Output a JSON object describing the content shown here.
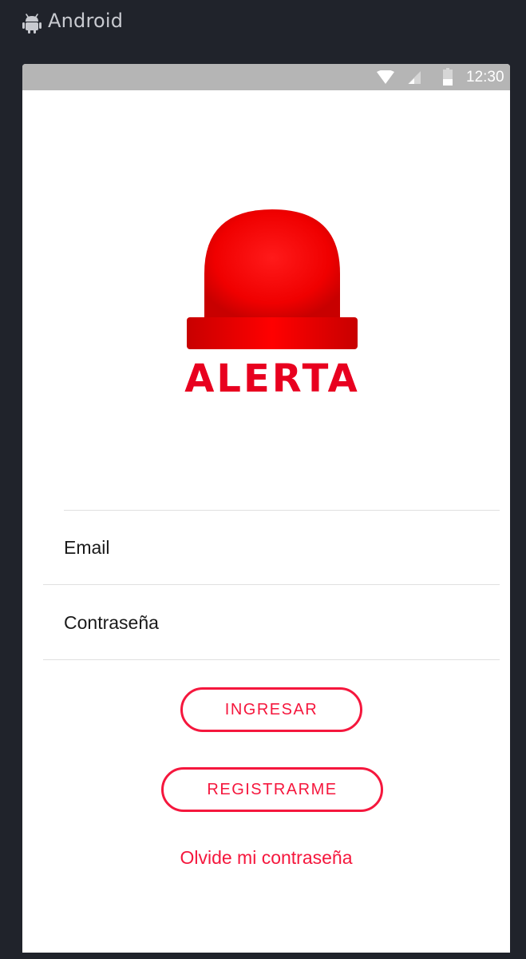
{
  "window": {
    "title": "Android",
    "icon": "android-robot-icon"
  },
  "status_bar": {
    "time": "12:30",
    "icons": [
      "wifi-icon",
      "signal-icon",
      "battery-icon"
    ]
  },
  "logo": {
    "text": "ALERTA",
    "icon": "siren-icon",
    "color": "#e8001f"
  },
  "form": {
    "email_placeholder": "Email",
    "password_placeholder": "Contraseña"
  },
  "buttons": {
    "login_label": "INGRESAR",
    "register_label": "REGISTRARME",
    "forgot_label": "Olvide mi contraseña"
  },
  "colors": {
    "accent": "#f5173d",
    "status_bar": "#b5b5b5",
    "chrome": "#20232b"
  }
}
